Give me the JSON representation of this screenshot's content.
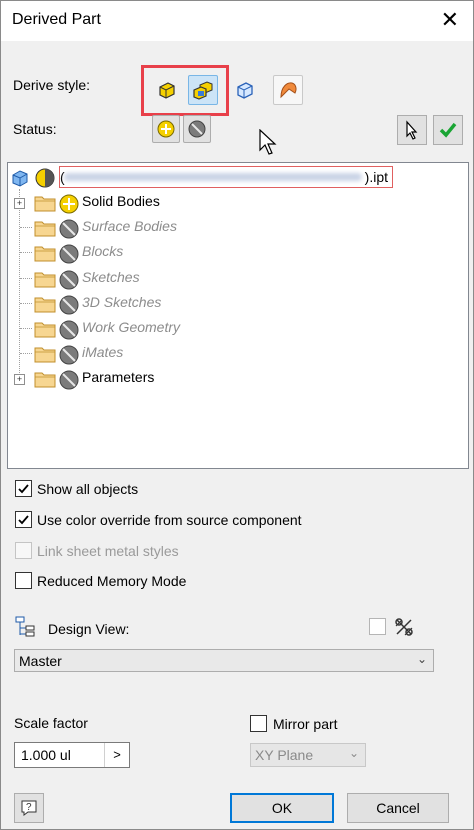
{
  "window": {
    "title": "Derived Part",
    "close_glyph": "✕"
  },
  "derive_style": {
    "label": "Derive style:",
    "buttons": [
      {
        "icon": "single-solid-icon",
        "selected": false
      },
      {
        "icon": "multiple-solid-icon",
        "selected": true
      },
      {
        "icon": "keep-seams-icon",
        "selected": false
      },
      {
        "icon": "surface-body-icon",
        "selected": false
      }
    ]
  },
  "status": {
    "label": "Status:",
    "buttons": [
      {
        "icon": "include-icon"
      },
      {
        "icon": "exclude-icon"
      }
    ]
  },
  "right_buttons": [
    {
      "icon": "select-pointer-icon"
    },
    {
      "icon": "ok-check-icon"
    }
  ],
  "tree": {
    "root": {
      "name_suffix": ").ipt",
      "name_prefix": "("
    },
    "items": [
      {
        "label": "Solid Bodies",
        "status": "include",
        "disabled": false,
        "expandable": true
      },
      {
        "label": "Surface Bodies",
        "status": "exclude",
        "disabled": true,
        "expandable": false
      },
      {
        "label": "Blocks",
        "status": "exclude",
        "disabled": true,
        "expandable": false
      },
      {
        "label": "Sketches",
        "status": "exclude",
        "disabled": true,
        "expandable": false
      },
      {
        "label": "3D Sketches",
        "status": "exclude",
        "disabled": true,
        "expandable": false
      },
      {
        "label": "Work Geometry",
        "status": "exclude",
        "disabled": true,
        "expandable": false
      },
      {
        "label": "iMates",
        "status": "exclude",
        "disabled": true,
        "expandable": false
      },
      {
        "label": "Parameters",
        "status": "exclude",
        "disabled": false,
        "expandable": true
      }
    ]
  },
  "options": {
    "show_all_objects": {
      "label": "Show all objects",
      "checked": true,
      "disabled": false
    },
    "color_override": {
      "label": "Use color override from source component",
      "checked": true,
      "disabled": false
    },
    "link_sheet_metal": {
      "label": "Link sheet metal styles",
      "checked": false,
      "disabled": true
    },
    "reduced_memory": {
      "label": "Reduced Memory Mode",
      "checked": false,
      "disabled": false
    }
  },
  "design_view": {
    "label": "Design View:",
    "value": "Master"
  },
  "scale": {
    "label": "Scale factor",
    "value": "1.000 ul",
    "arrow": ">"
  },
  "mirror": {
    "label": "Mirror part",
    "checked": false,
    "plane": "XY Plane"
  },
  "footer": {
    "help_icon": "help-icon",
    "ok_label": "OK",
    "cancel_label": "Cancel"
  },
  "colors": {
    "accent": "#0078d7",
    "highlight_box": "#e8404a",
    "yellow_icon": "#f5d000",
    "include_green": "#1aa534"
  }
}
